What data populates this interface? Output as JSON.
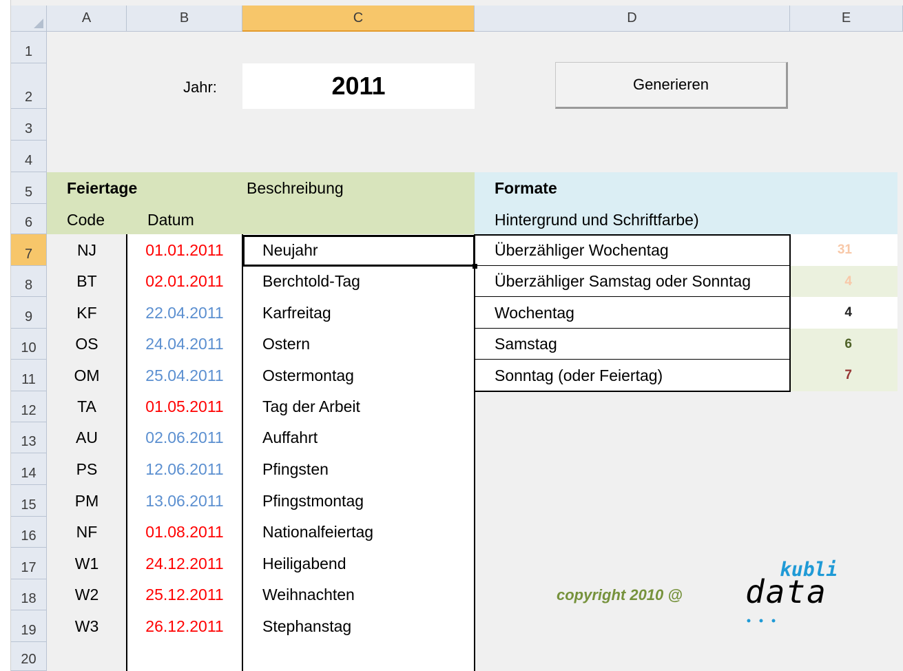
{
  "columns": [
    "A",
    "B",
    "C",
    "D",
    "E"
  ],
  "row_numbers": [
    "1",
    "2",
    "3",
    "4",
    "5",
    "6",
    "7",
    "8",
    "9",
    "10",
    "11",
    "12",
    "13",
    "14",
    "15",
    "16",
    "17",
    "18",
    "19",
    "20"
  ],
  "year_label": "Jahr:",
  "year_value": "2011",
  "generate_button": "Generieren",
  "section_holidays": {
    "title": "Feiertage",
    "description_header": "Beschreibung",
    "code_header": "Code",
    "date_header": "Datum"
  },
  "section_formats": {
    "title": "Formate",
    "subtitle": "Hintergrund und Schriftfarbe)"
  },
  "holidays": [
    {
      "code": "NJ",
      "date": "01.01.2011",
      "desc": "Neujahr",
      "date_color": "#ff0000"
    },
    {
      "code": "BT",
      "date": "02.01.2011",
      "desc": "Berchtold-Tag",
      "date_color": "#ff0000"
    },
    {
      "code": "KF",
      "date": "22.04.2011",
      "desc": "Karfreitag",
      "date_color": "#5b8fd0"
    },
    {
      "code": "OS",
      "date": "24.04.2011",
      "desc": "Ostern",
      "date_color": "#5b8fd0"
    },
    {
      "code": "OM",
      "date": "25.04.2011",
      "desc": "Ostermontag",
      "date_color": "#5b8fd0"
    },
    {
      "code": "TA",
      "date": "01.05.2011",
      "desc": "Tag der Arbeit",
      "date_color": "#ff0000"
    },
    {
      "code": "AU",
      "date": "02.06.2011",
      "desc": "Auffahrt",
      "date_color": "#5b8fd0"
    },
    {
      "code": "PS",
      "date": "12.06.2011",
      "desc": "Pfingsten",
      "date_color": "#5b8fd0"
    },
    {
      "code": "PM",
      "date": "13.06.2011",
      "desc": "Pfingstmontag",
      "date_color": "#5b8fd0"
    },
    {
      "code": "NF",
      "date": "01.08.2011",
      "desc": "Nationalfeiertag",
      "date_color": "#ff0000"
    },
    {
      "code": "W1",
      "date": "24.12.2011",
      "desc": "Heiligabend",
      "date_color": "#ff0000"
    },
    {
      "code": "W2",
      "date": "25.12.2011",
      "desc": "Weihnachten",
      "date_color": "#ff0000"
    },
    {
      "code": "W3",
      "date": "26.12.2011",
      "desc": "Stephanstag",
      "date_color": "#ff0000"
    }
  ],
  "formats": [
    {
      "label": "Überzähliger Wochentag",
      "sample": "31",
      "bg": "#ffffff",
      "fg": "#f8c8a8"
    },
    {
      "label": "Überzähliger Samstag oder Sonntag",
      "sample": "4",
      "bg": "#ebf1de",
      "fg": "#f8c8a8"
    },
    {
      "label": "Wochentag",
      "sample": "4",
      "bg": "#ffffff",
      "fg": "#222222"
    },
    {
      "label": "Samstag",
      "sample": "6",
      "bg": "#ebf1de",
      "fg": "#4f6228"
    },
    {
      "label": "Sonntag (oder Feiertag)",
      "sample": "7",
      "bg": "#ebf1de",
      "fg": "#963634"
    }
  ],
  "copyright": "copyright 2010 @",
  "logo": {
    "top": "kubli",
    "bottom": "data"
  },
  "colors": {
    "header_bg": "#e4e9f1",
    "selected_header": "#f7c66a",
    "green_section": "#d8e4bc",
    "blue_section": "#dbeef4",
    "copyright": "#76923c",
    "logo_blue": "#1f9ad6"
  }
}
